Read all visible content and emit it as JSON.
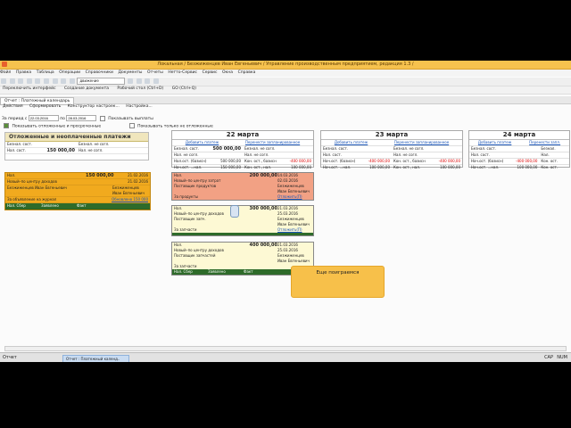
{
  "window": {
    "title": "Локальная / Безжиженцев Иван Евгеньевич / Управление производственным предприятием, редакция 1.3 /"
  },
  "menu": [
    "Файл",
    "Правка",
    "Таблица",
    "Операции",
    "Справочники",
    "Документы",
    "Отчеты",
    "Нетто-Сервис",
    "Сервис",
    "Окна",
    "Справка"
  ],
  "toolbar2": {
    "left": "Переключить интерфейс",
    "middle": "Создание документа",
    "right": "Рабочий стол (Ctrl+D)",
    "far": "GO (Ctrl+Q)"
  },
  "toolbar_search": "движение",
  "tab": {
    "label": "Отчет : Платежный календарь"
  },
  "actions": [
    "Действия",
    "Сформировать",
    "Конструктор настроек...",
    "Настройка..."
  ],
  "params": {
    "period_label": "За период с",
    "from": "22.03.2016",
    "to_label": "по",
    "to": "28.03.2016",
    "show_paid": "Показывать выплаты",
    "show_deferred": "Показывать отложенные и просроченные",
    "show_only_deferred": "Показывать только не отложенные"
  },
  "left_panel": {
    "title": "Отложенные и неоплаченные платежи",
    "rows": [
      {
        "a": "Безнал. сост.",
        "b": "Безнал. не согл."
      },
      {
        "a": "Нал. сост.",
        "b": "Нал. не согл."
      }
    ],
    "value": "150 000,00"
  },
  "left_card": {
    "r1_label": "Нал.",
    "r1_amount": "150 000,00",
    "r1_date": "21.02.2016",
    "r2_label": "Новый–по центру доходов",
    "r2_date": "21.02.2016",
    "r3_label": "Безжиженцев Иван Евгеньевич",
    "r3_right": "Безжиженцев Иван Евгеньевич",
    "r4_label": "За объявление на журнал",
    "r4_right": "Обновлено 150 000",
    "r5": [
      "Нал. Сбер",
      "Заявлено",
      "Факт"
    ]
  },
  "days": [
    {
      "title": "22 марта",
      "links": [
        "Добавить платеж",
        "Перенести запланированное"
      ],
      "rows": [
        {
          "a": "Безнал. сост.",
          "av": "500 000,00",
          "b": "Безнал. не согл.",
          "bv": ""
        },
        {
          "a": "Нал. не согл.",
          "av": "",
          "b": "Нал. не согл.",
          "bv": ""
        },
        {
          "a": "Нал.ост. (базисн)",
          "av": "500 000,00",
          "b": "Кон. ост., базисн",
          "bv": "-400 000,00"
        },
        {
          "a": "Нач.ост. ...нал.",
          "av": "150 000,00",
          "b": "Кон. ост., нал.",
          "bv": "100 000,00"
        }
      ]
    },
    {
      "title": "23 марта",
      "links": [
        "Добавить платеж",
        "Перенести запланированное"
      ],
      "rows": [
        {
          "a": "Безнал. сост.",
          "av": "",
          "b": "Безнал. не согл.",
          "bv": ""
        },
        {
          "a": "Нал. сост.",
          "av": "",
          "b": "Нал. не согл.",
          "bv": ""
        },
        {
          "a": "Нач.ост. (базисн)",
          "av": "-400 000,00",
          "b": "Кон. ост., базисн",
          "bv": "-400 000,00"
        },
        {
          "a": "Нач.ост. ...нал.",
          "av": "100 000,00",
          "b": "Кон. ост., нал.",
          "bv": "100 000,00"
        }
      ]
    },
    {
      "title": "24 марта",
      "links": [
        "Добавить платеж",
        "Перенести запл."
      ],
      "rows": [
        {
          "a": "Безнал. сост.",
          "av": "",
          "b": "Безнал.",
          "bv": ""
        },
        {
          "a": "Нал. сост.",
          "av": "",
          "b": "Нал.",
          "bv": ""
        },
        {
          "a": "Нач.ост. (базисн)",
          "av": "-400 000,00",
          "b": "Кон. ост.",
          "bv": ""
        },
        {
          "a": "Нач.ост. ...нал.",
          "av": "100 000,00",
          "b": "Кон. ост.",
          "bv": ""
        }
      ]
    }
  ],
  "payments": [
    {
      "head": "Нал.",
      "amount": "200 000,00",
      "date": "14.03.2016",
      "r2": "Новый–по центру затрат",
      "r2d": "02.03.2016",
      "r3": "Поставщик продуктов",
      "r3r": "Безжиженцев",
      "r3r2": "Иван Евгеньевич",
      "r4": "За продукты",
      "link": "Отложить(П)"
    },
    {
      "head": "Нал.",
      "amount": "300 000,00",
      "date": "21.03.2016",
      "r2": "Новый–по центру доходов",
      "r2d": "25.03.2016",
      "r3": "Поставщик запч.",
      "r3r": "Безжиженцев",
      "r3r2": "Иван Евгеньевич",
      "r4": "За запчасти",
      "link": "Отложить(П)"
    },
    {
      "head": "Нал.",
      "amount": "400 000,00",
      "date": "21.03.2016",
      "r2": "Новый–по центру доходов",
      "r2d": "25.03.2016",
      "r3": "Поставщик запчастей",
      "r3r": "Безжиженцев",
      "r3r2": "Иван Евгеньевич",
      "r4": "За запчасти",
      "link": "",
      "foot": [
        "Нал. Сбер",
        "Заявлено",
        "Факт"
      ]
    }
  ],
  "tooltip": {
    "text": "Еще поиграемся"
  },
  "status": {
    "tab": "Отчет : Платежный календ..",
    "left": "Отчет",
    "right1": "CAP",
    "right2": "NUM"
  }
}
